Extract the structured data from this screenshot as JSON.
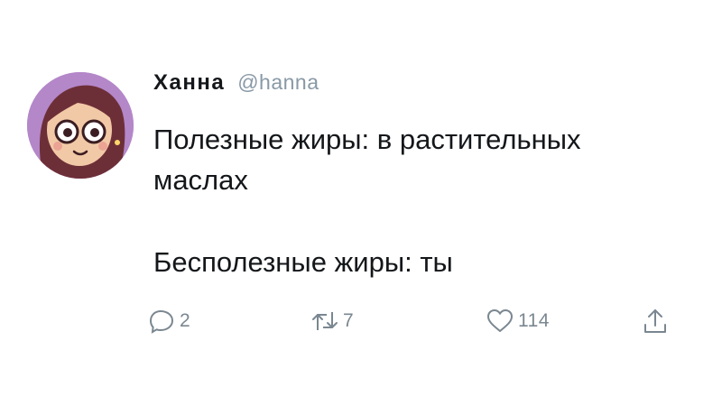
{
  "author": {
    "display_name": "Ханна",
    "handle": "@hanna"
  },
  "tweet": {
    "lines": [
      "Полезные жиры: в растительных",
      "маслах",
      "",
      "Бесполезные жиры: ты"
    ]
  },
  "actions": {
    "reply_count": "2",
    "retweet_count": "7",
    "like_count": "114"
  },
  "colors": {
    "avatar_bg": "#b487c9",
    "icon_gray": "#7a8791",
    "handle_gray": "#8899a6",
    "text": "#14171a"
  }
}
